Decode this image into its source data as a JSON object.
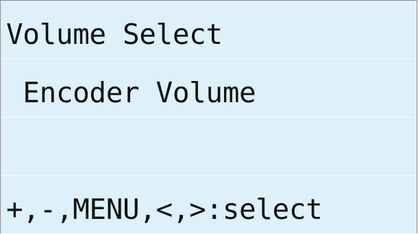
{
  "display": {
    "lines": [
      "Volume Select",
      " Encoder Volume",
      "",
      "+,-,MENU,<,>:select"
    ]
  },
  "colors": {
    "background": "#def0fa",
    "text": "#111111",
    "border": "#8a8a8a"
  }
}
